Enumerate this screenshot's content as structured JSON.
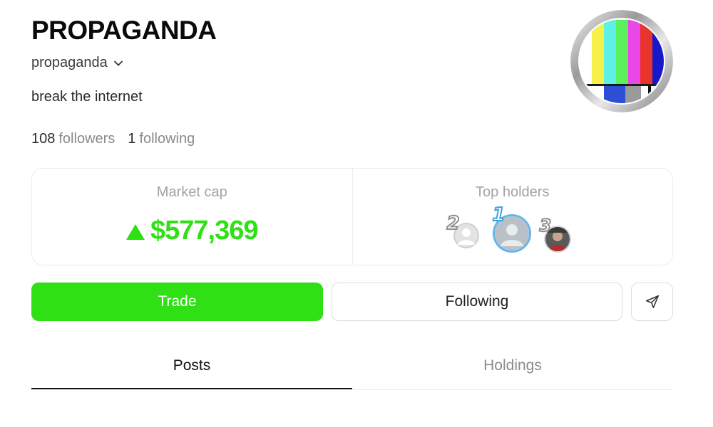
{
  "profile": {
    "title": "PROPAGANDA",
    "username": "propaganda",
    "bio": "break the internet",
    "followers_count": "108",
    "followers_label": "followers",
    "following_count": "1",
    "following_label": "following"
  },
  "stats_card": {
    "market_cap_label": "Market cap",
    "market_cap_value": "$577,369",
    "market_cap_trend": "up",
    "top_holders_label": "Top holders",
    "holders": [
      {
        "rank": "2"
      },
      {
        "rank": "1"
      },
      {
        "rank": "3"
      }
    ]
  },
  "actions": {
    "trade_label": "Trade",
    "following_label": "Following",
    "share_icon": "send-icon"
  },
  "tabs": [
    {
      "label": "Posts",
      "active": true
    },
    {
      "label": "Holdings",
      "active": false
    }
  ],
  "colors": {
    "accent_green": "#2ee014",
    "muted_text": "#8a8a8a"
  }
}
